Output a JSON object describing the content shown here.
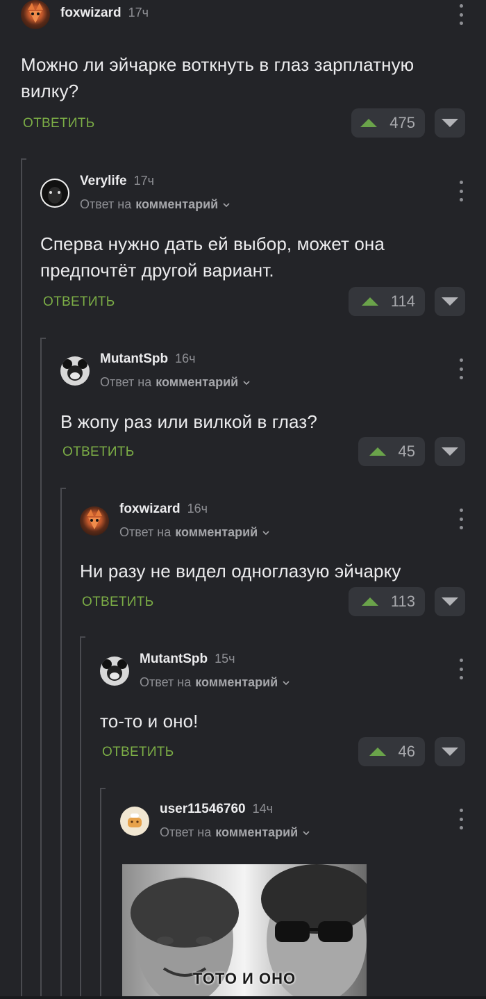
{
  "ui": {
    "reply_label": "ОТВЕТИТЬ",
    "reply_to_prefix": "Ответ на",
    "reply_to_link": "комментарий"
  },
  "comments": [
    {
      "user": "foxwizard",
      "time": "17ч",
      "text": "Можно ли эйчарке воткнуть в глаз зарплатную вилку?",
      "votes": "475"
    },
    {
      "user": "Verylife",
      "time": "17ч",
      "text": "Сперва нужно дать ей выбор, может она предпочтёт другой вариант.",
      "votes": "114"
    },
    {
      "user": "MutantSpb",
      "time": "16ч",
      "text": "В жопу раз или вилкой в глаз?",
      "votes": "45"
    },
    {
      "user": "foxwizard",
      "time": "16ч",
      "text": "Ни разу не видел одноглазую эйчарку",
      "votes": "113"
    },
    {
      "user": "MutantSpb",
      "time": "15ч",
      "text": "то-то и оно!",
      "votes": "46"
    },
    {
      "user": "user11546760",
      "time": "14ч"
    }
  ],
  "meme": {
    "caption": "ТОТО И ОНО"
  },
  "colors": {
    "background": "#232428",
    "accent_green": "#7cae46",
    "upvote_arrow": "#6aa34a"
  }
}
